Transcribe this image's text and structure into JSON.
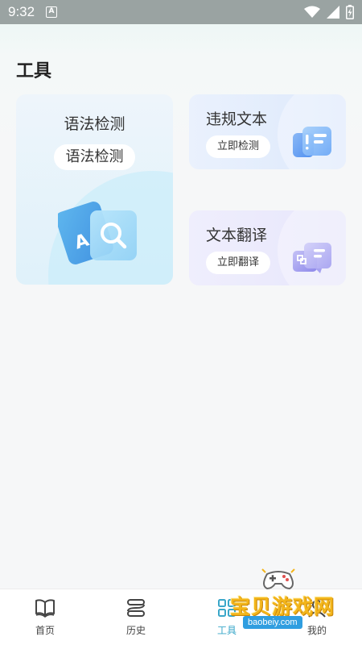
{
  "status_bar": {
    "time": "9:32",
    "notification_icon": "a-badge-icon",
    "icons": [
      "wifi-icon",
      "signal-icon",
      "battery-charging-icon"
    ]
  },
  "page": {
    "title": "工具"
  },
  "cards": {
    "grammar": {
      "title": "语法检测",
      "button": "语法检测",
      "icon": "grammar-search-icon",
      "accent": "#7fc6ec"
    },
    "violation": {
      "title": "违规文本",
      "button": "立即检测",
      "icon": "violation-text-icon",
      "accent": "#5b9cf2"
    },
    "translate": {
      "title": "文本翻译",
      "button": "立即翻译",
      "icon": "translate-icon",
      "accent": "#8f8ae8"
    }
  },
  "nav": {
    "items": [
      {
        "label": "首页",
        "icon": "book-icon"
      },
      {
        "label": "历史",
        "icon": "history-icon"
      },
      {
        "label": "工具",
        "icon": "tools-icon"
      },
      {
        "label": "我的",
        "icon": "profile-icon"
      }
    ],
    "active_index": 2,
    "active_color": "#3aa7c9"
  },
  "watermark": {
    "text": "宝贝游戏网",
    "url": "baobeiy.com"
  }
}
